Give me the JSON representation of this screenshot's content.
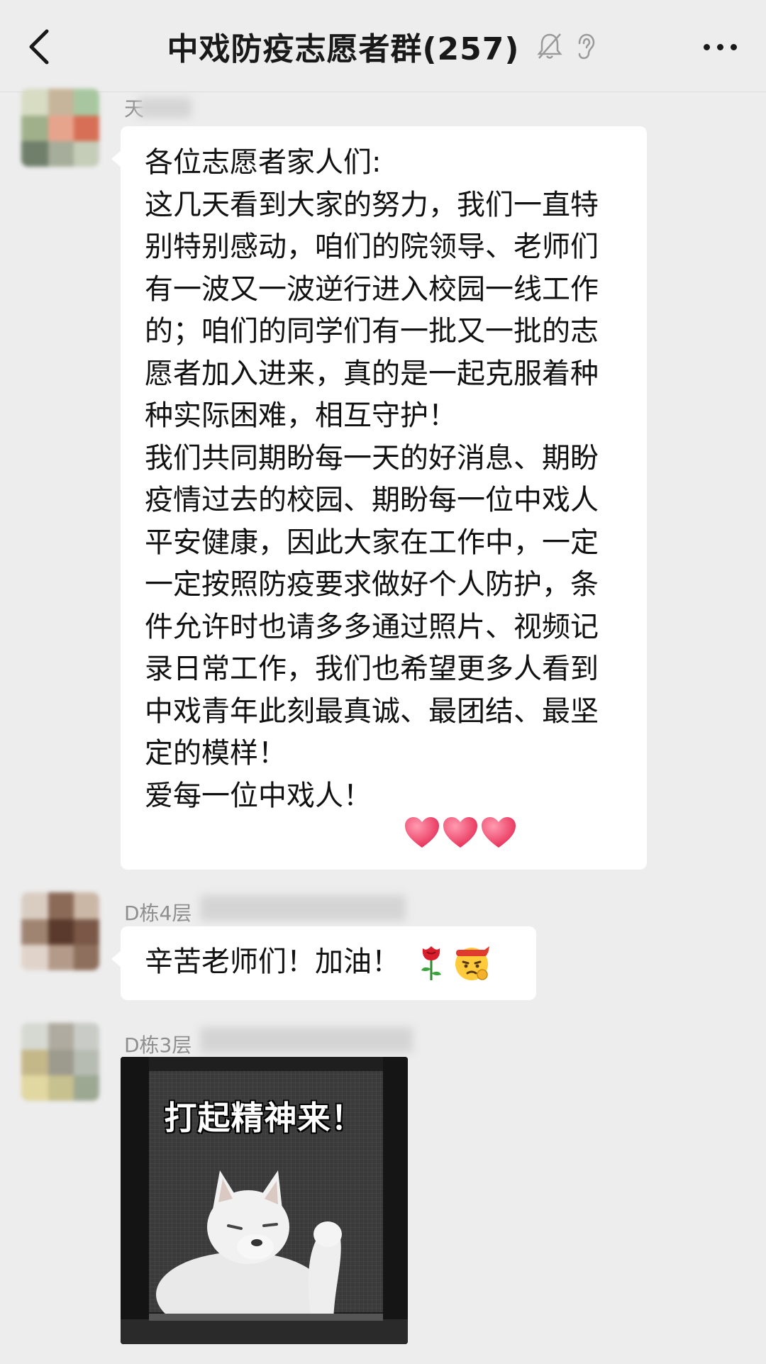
{
  "header": {
    "back_icon": "chevron-left-icon",
    "title": "中戏防疫志愿者群(257)",
    "mute_icon": "bell-muted-icon",
    "ear_icon": "ear-icon",
    "more_icon": "more-dots-icon"
  },
  "messages": [
    {
      "sender": "天",
      "text": "各位志愿者家人们:\n这几天看到大家的努力，我们一直特别特别感动，咱们的院领导、老师们有一波又一波逆行进入校园一线工作的；咱们的同学们有一批又一批的志愿者加入进来，真的是一起克服着种种实际困难，相互守护！\n我们共同期盼每一天的好消息、期盼疫情过去的校园、期盼每一位中戏人平安健康，因此大家在工作中，一定一定按照防疫要求做好个人防护，条件允许时也请多多通过照片、视频记录日常工作，我们也希望更多人看到中戏青年此刻最真诚、最团结、最坚定的模样！\n爱每一位中戏人！",
      "emojis": [
        "heart-icon",
        "heart-icon",
        "heart-icon"
      ]
    },
    {
      "sender": "D栋4层",
      "text": "辛苦老师们！加油！",
      "emojis": [
        "rose-icon",
        "fighting-face-icon"
      ]
    },
    {
      "sender": "D栋3层",
      "sticker_caption": "打起精神来！",
      "sticker_icon": "white-dog-sticker"
    }
  ],
  "colors": {
    "background": "#ededed",
    "bubble": "#ffffff",
    "heart": "#f0446a"
  }
}
